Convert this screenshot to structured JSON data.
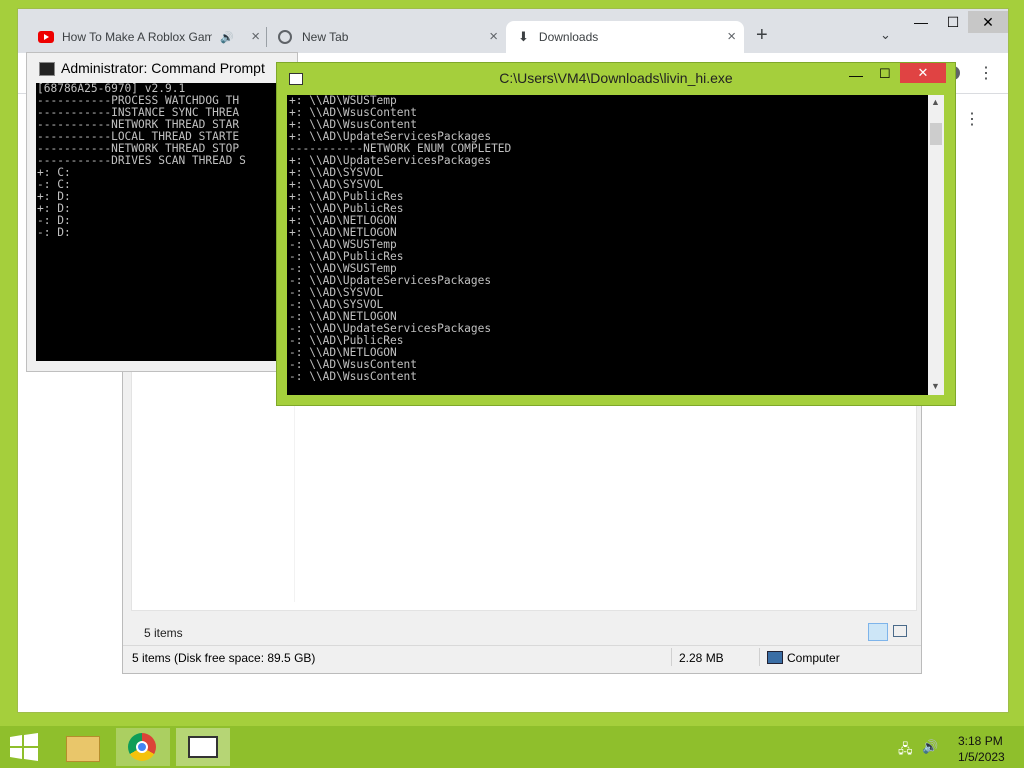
{
  "chrome": {
    "tabs": [
      {
        "title": "How To Make A Roblox Game",
        "icon": "youtube-icon"
      },
      {
        "title": "New Tab",
        "icon": "chrome-icon"
      },
      {
        "title": "Downloads",
        "icon": "download-icon"
      }
    ],
    "new_tab_label": "+"
  },
  "explorer": {
    "items_count": "5 items",
    "status_left": "5 items (Disk free space: 89.5 GB)",
    "status_size": "2.28 MB",
    "status_location": "Computer"
  },
  "cmd_admin": {
    "title": "Administrator: Command Prompt",
    "lines": [
      "[68786A25-6970] v2.9.1",
      "-----------PROCESS WATCHDOG TH",
      "-----------INSTANCE SYNC THREA",
      "-----------NETWORK THREAD STAR",
      "-----------LOCAL THREAD STARTE",
      "-----------NETWORK THREAD STOP",
      "-----------DRIVES SCAN THREAD S",
      "+: C:",
      "-: C:",
      "+: D:",
      "+: D:",
      "-: D:",
      "-: D:"
    ]
  },
  "livin": {
    "title": "C:\\Users\\VM4\\Downloads\\livin_hi.exe",
    "lines": [
      "+: \\\\AD\\WSUSTemp",
      "+: \\\\AD\\WsusContent",
      "+: \\\\AD\\WsusContent",
      "+: \\\\AD\\UpdateServicesPackages",
      "-----------NETWORK ENUM COMPLETED",
      "+: \\\\AD\\UpdateServicesPackages",
      "+: \\\\AD\\SYSVOL",
      "+: \\\\AD\\SYSVOL",
      "+: \\\\AD\\PublicRes",
      "+: \\\\AD\\PublicRes",
      "+: \\\\AD\\NETLOGON",
      "+: \\\\AD\\NETLOGON",
      "-: \\\\AD\\WSUSTemp",
      "-: \\\\AD\\PublicRes",
      "-: \\\\AD\\WSUSTemp",
      "-: \\\\AD\\UpdateServicesPackages",
      "-: \\\\AD\\SYSVOL",
      "-: \\\\AD\\SYSVOL",
      "-: \\\\AD\\NETLOGON",
      "-: \\\\AD\\UpdateServicesPackages",
      "-: \\\\AD\\PublicRes",
      "-: \\\\AD\\NETLOGON",
      "-: \\\\AD\\WsusContent",
      "-: \\\\AD\\WsusContent"
    ]
  },
  "taskbar": {
    "time": "3:18 PM",
    "date": "1/5/2023"
  },
  "colors": {
    "desktop": "#a5cf3c",
    "taskbar": "#8fbf2c",
    "console_bg": "#000000",
    "console_fg": "#c0c0c0",
    "close_red": "#e04343"
  }
}
